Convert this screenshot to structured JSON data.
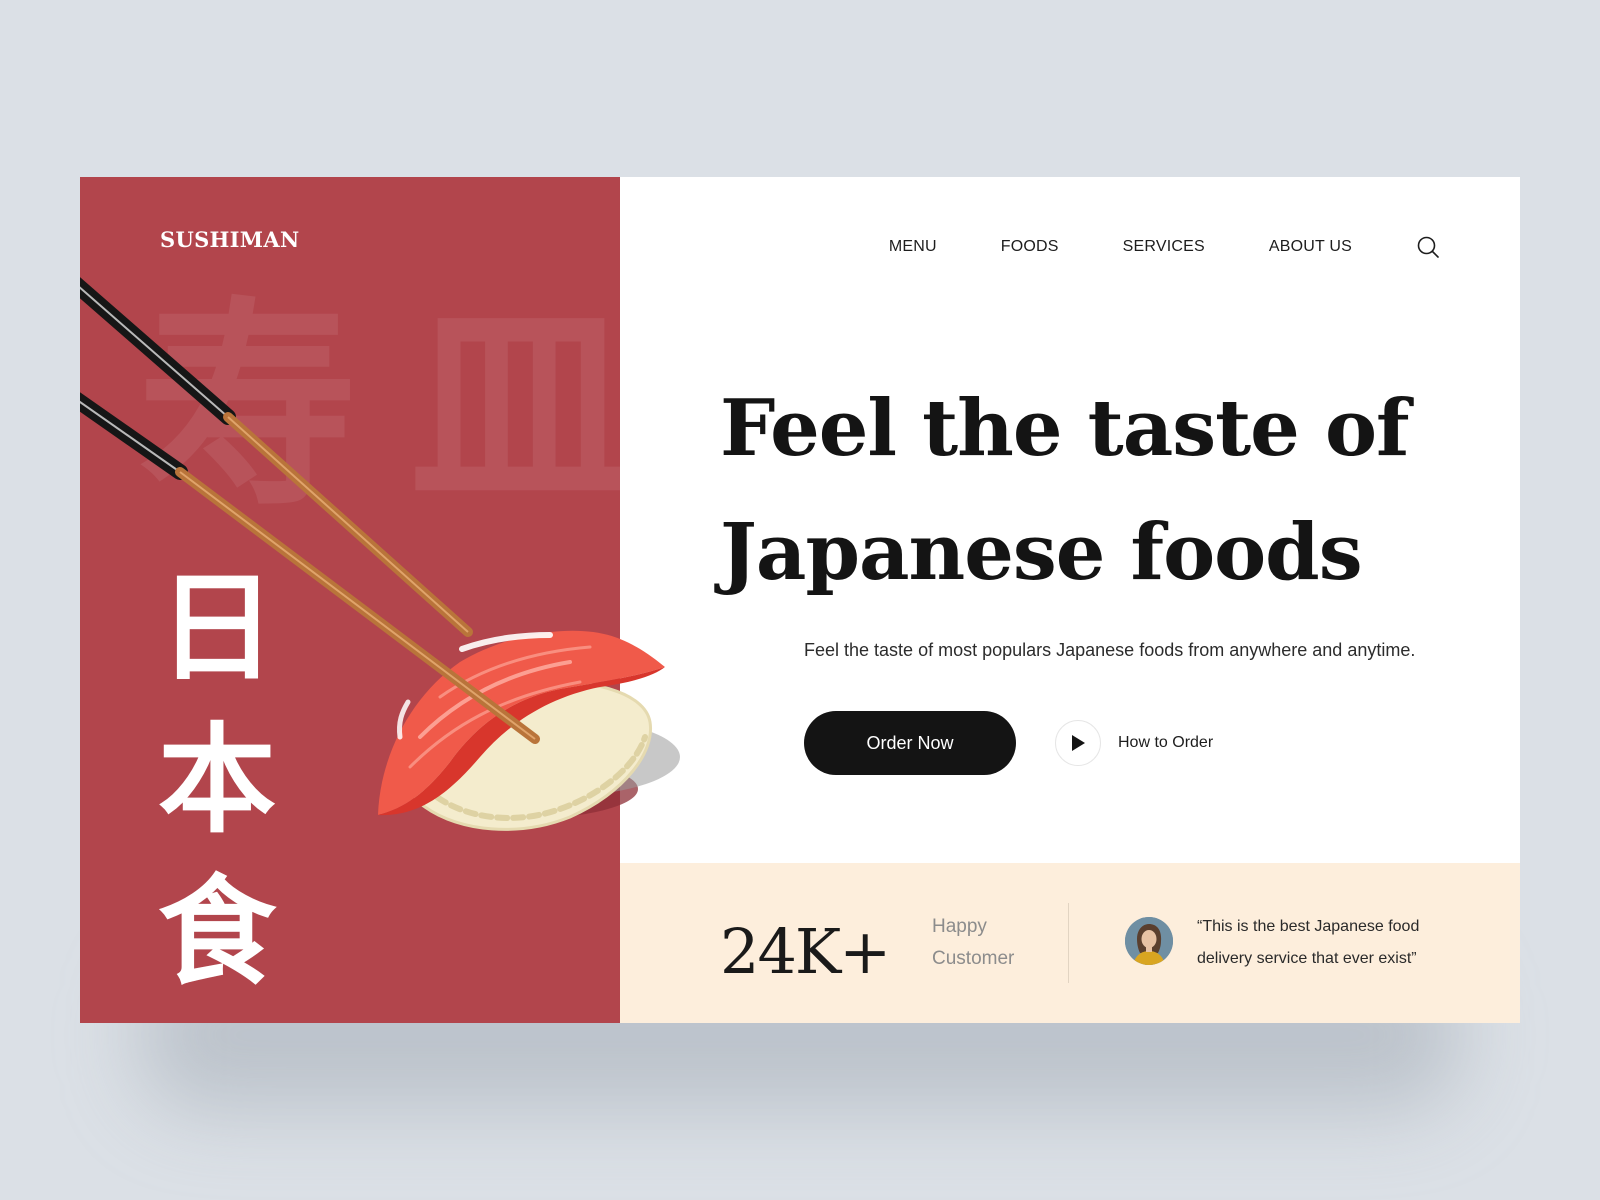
{
  "brand": {
    "name": "SUSHIMAN"
  },
  "nav": {
    "items": [
      {
        "label": "MENU"
      },
      {
        "label": "FOODS"
      },
      {
        "label": "SERVICES"
      },
      {
        "label": "ABOUT US"
      }
    ],
    "search_icon": "search-icon"
  },
  "left_panel": {
    "vertical_kanji": [
      "日",
      "本",
      "食"
    ],
    "background_kanji": [
      "寿",
      "皿"
    ]
  },
  "hero": {
    "title_line_1": "Feel the taste of",
    "title_line_2": "Japanese foods",
    "subtitle": "Feel the taste of most populars Japanese foods from anywhere and anytime.",
    "cta_label": "Order Now",
    "secondary_label": "How to Order",
    "secondary_icon": "play-icon"
  },
  "stats": {
    "number": "24K+",
    "label_line_1": "Happy",
    "label_line_2": "Customer",
    "testimonial_line_1": "“This is the best Japanese food",
    "testimonial_line_2": "delivery service that ever exist”"
  },
  "colors": {
    "brand_red": "#b2454c",
    "dark": "#141414",
    "cream": "#fdeedc",
    "page_bg": "#dbe0e6"
  }
}
